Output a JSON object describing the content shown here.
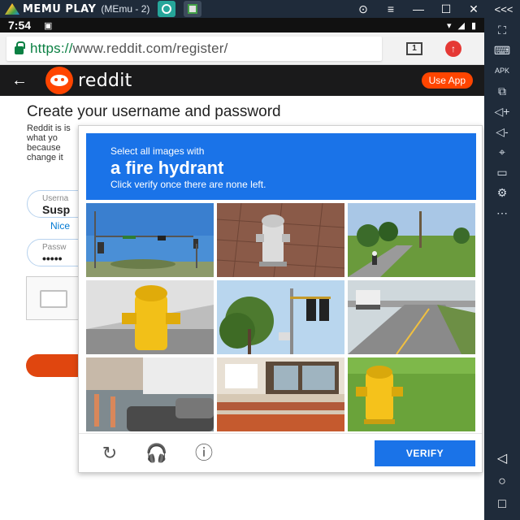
{
  "emulator": {
    "brand": "MEMU PLAY",
    "instance": "(MEmu - 2)",
    "controls": [
      "⊙",
      "≡",
      "—",
      "☐",
      "✕",
      "<<<"
    ],
    "side_tools": [
      "⛶",
      "⌨",
      "APK",
      "⧉",
      "◁+",
      "◁-",
      "⌖",
      "▭",
      "⚙",
      "⋯"
    ],
    "nav": [
      "◁",
      "○",
      "□"
    ]
  },
  "status_bar": {
    "time": "7:54",
    "notif": "▣",
    "icons": [
      "▾",
      "◢",
      "▮"
    ]
  },
  "browser": {
    "url_scheme": "https://",
    "url_rest": "www.reddit.com/register/",
    "tab_count": "1"
  },
  "reddit": {
    "wordmark": "reddit",
    "use_app": "Use App"
  },
  "page": {
    "title": "Create your username and password",
    "description": "Reddit is is what yo because change it",
    "username_label": "Userna",
    "username_value": "Susp",
    "nice": "Nice",
    "password_label": "Passw",
    "password_value": "•••••"
  },
  "captcha": {
    "line1": "Select all images with",
    "target": "a fire hydrant",
    "line3": "Click verify once there are none left.",
    "verify_label": "VERIFY",
    "tiles": [
      "traffic-signal-street",
      "fire-hydrant-brick",
      "road-with-cyclist",
      "yellow-fire-hydrant",
      "tree-traffic-light",
      "highway-truck",
      "parked-cars",
      "storefront",
      "yellow-hydrant-grass"
    ]
  }
}
